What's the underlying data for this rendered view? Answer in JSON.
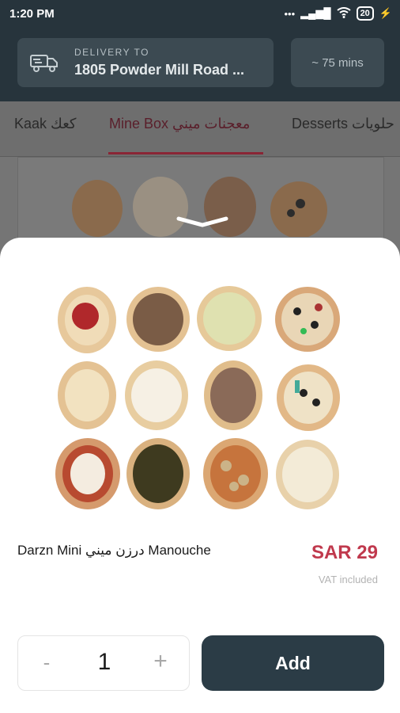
{
  "status_bar": {
    "time": "1:20 PM",
    "dots": "•••",
    "signal": "▂▄▆█",
    "battery": "20"
  },
  "header": {
    "delivery_label": "DELIVERY TO",
    "delivery_address": "1805 Powder Mill Road ...",
    "eta": "~ 75 mins"
  },
  "tabs": [
    {
      "label": "Kaak كعك"
    },
    {
      "label": "Mine Box معجنات ميني",
      "active": true
    },
    {
      "label": "Desserts حلويات"
    }
  ],
  "product": {
    "name": "Darzn Mini درزن ميني Manouche",
    "price": "SAR 29",
    "vat_note": "VAT included"
  },
  "quantity": {
    "minus": "-",
    "value": "1",
    "plus": "+"
  },
  "add_label": "Add",
  "colors": {
    "accent": "#c0394d",
    "primary": "#2b3c46",
    "header_bg": "#27343c"
  }
}
